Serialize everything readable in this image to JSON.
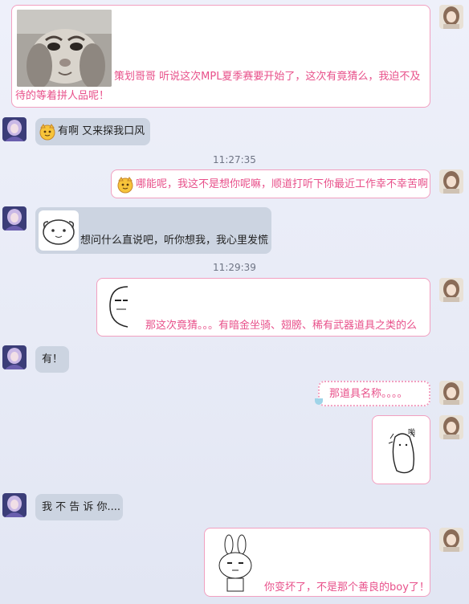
{
  "messages": [
    {
      "sender": "me",
      "text_line1": "策划哥哥 听说这次MPL夏季赛要开始了，这次有竟猜么，我迫不及",
      "text_line2": "待的等着拼人品呢！",
      "sticker": "rabbit-photo"
    },
    {
      "sender": "other",
      "text": "有啊 又来探我口风",
      "emoji": "cat-face-emoji"
    },
    {
      "time": "11:27:35"
    },
    {
      "sender": "me",
      "text": "哪能呢，我这不是想你呢嘛，顺道打听下你最近工作幸不幸苦啊",
      "emoji": "cat-face-emoji"
    },
    {
      "sender": "other",
      "text": "想问什么直说吧，听你想我，我心里发慌",
      "sticker": "sheep-sticker"
    },
    {
      "time": "11:29:39"
    },
    {
      "sender": "me",
      "text": "那这次竟猜。。。有暗金坐骑、翅膀、稀有武器道具之类的么",
      "sticker": "peek-face-sticker"
    },
    {
      "sender": "other",
      "text": "有！"
    },
    {
      "sender": "me",
      "text": "那道具名称。。。。",
      "bubble_style": "lace"
    },
    {
      "sender": "me",
      "sticker": "scared-sticker",
      "sticker_text": "啪"
    },
    {
      "sender": "other",
      "text": "我 不 告 诉 你...."
    },
    {
      "sender": "me",
      "text": "你变坏了，不是那个善良的boy了！",
      "sticker": "bunny-sticker"
    }
  ],
  "colors": {
    "me_text": "#e8508a",
    "me_border": "#f2a0c0",
    "other_bubble": "#ccd4e1",
    "time": "#6e7484"
  }
}
